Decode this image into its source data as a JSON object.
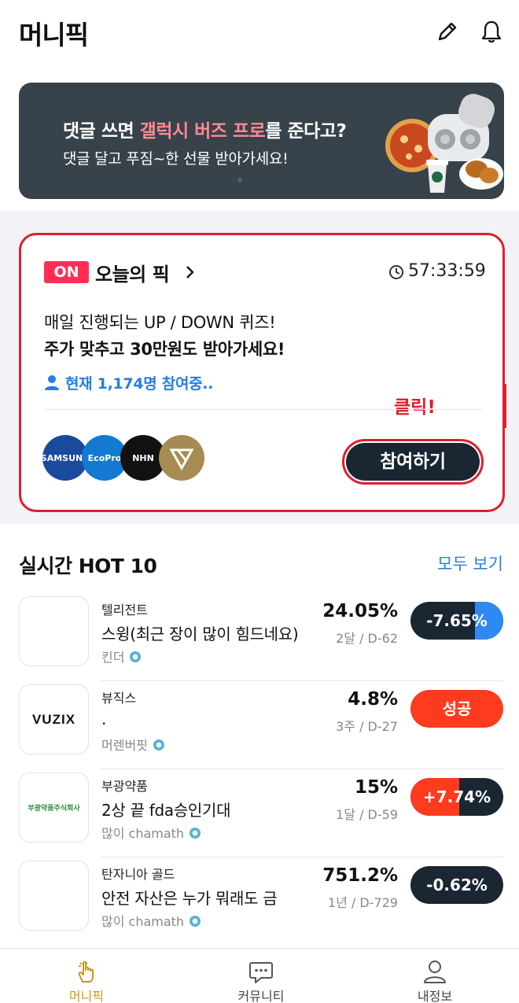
{
  "header": {
    "title": "머니픽",
    "icons": [
      "pencil-icon",
      "bell-icon"
    ]
  },
  "banner": {
    "line1_prefix": "댓글 쓰면 ",
    "line1_highlight": "갤럭시 버즈 프로",
    "line1_suffix": "를 준다고?",
    "line2": "댓글 달고 푸짐~한 선물 받아가세요!",
    "highlight_color": "#ff8a8e"
  },
  "today_pick": {
    "badge": "ON",
    "title": "오늘의 픽",
    "timer": "57:33:59",
    "desc1": "매일 진행되는 UP / DOWN 퀴즈!",
    "desc2": "주가 맞추고 30만원도 받아가세요!",
    "participants": "현재 1,174명 참여중..",
    "logos": [
      "SAMSUNG",
      "EcoPro",
      "NHN",
      "gold-triangle-logo"
    ],
    "join_button": "참여하기",
    "click_note": "클릭!"
  },
  "hot": {
    "title": "실시간 HOT 10",
    "see_all": "모두 보기",
    "items": [
      {
        "stock": "텔리전트",
        "comment": "스윙(최근 장이 많이 힘드네요)",
        "author": "킨더",
        "pct": "24.05%",
        "period": "2달 / D-62",
        "status": "-7.65%",
        "thumb": ""
      },
      {
        "stock": "뷰직스",
        "comment": ".",
        "author": "머렌버핏",
        "pct": "4.8%",
        "period": "3주 / D-27",
        "status": "성공",
        "thumb": "VUZIX"
      },
      {
        "stock": "부광약품",
        "comment": "2상 끝 fda승인기대",
        "author": "많이 chamath",
        "pct": "15%",
        "period": "1달 / D-59",
        "status": "+7.74%",
        "thumb": "부광약품주식회사"
      },
      {
        "stock": "탄자니아 골드",
        "comment": "안전 자산은 누가 뭐래도 금",
        "author": "많이 chamath",
        "pct": "751.2%",
        "period": "1년 / D-729",
        "status": "-0.62%",
        "thumb": ""
      }
    ]
  },
  "nav": {
    "items": [
      {
        "label": "머니픽",
        "icon": "hand-pointer-icon",
        "active": true
      },
      {
        "label": "커뮤니티",
        "icon": "chat-bubble-icon",
        "active": false
      },
      {
        "label": "내정보",
        "icon": "person-icon",
        "active": false
      }
    ]
  },
  "colors": {
    "accent_blue": "#2a7de1",
    "alert_red": "#e01e2d",
    "success_red": "#ff3b1f",
    "dark_navy": "#1b2633",
    "nav_active_gold": "#c9961e"
  }
}
